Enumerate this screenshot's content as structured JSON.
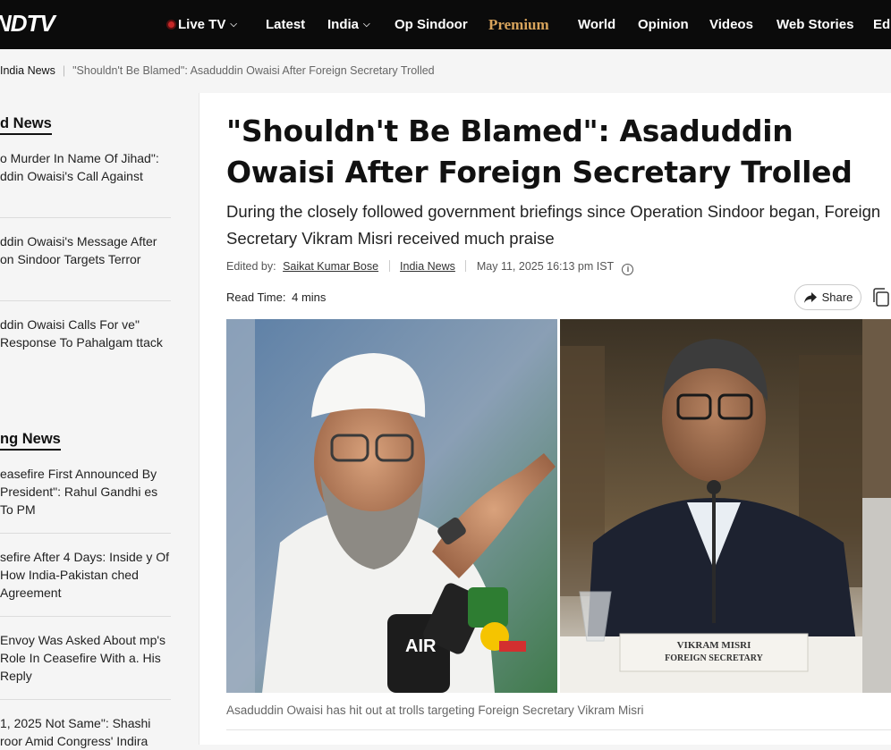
{
  "nav": {
    "logo": "NDTV",
    "items": [
      {
        "label": "Live TV",
        "has_dot": true,
        "has_chevron": true
      },
      {
        "label": "Latest"
      },
      {
        "label": "India",
        "has_chevron": true
      },
      {
        "label": "Op Sindoor"
      },
      {
        "label": "Premium"
      },
      {
        "label": "World"
      },
      {
        "label": "Opinion"
      },
      {
        "label": "Videos"
      },
      {
        "label": "Web Stories"
      },
      {
        "label": "Edu"
      }
    ]
  },
  "breadcrumb": {
    "parent": "India News",
    "current": "\"Shouldn't Be Blamed\": Asaduddin Owaisi After Foreign Secretary Trolled"
  },
  "sidebar": {
    "sections": [
      {
        "title": "d News",
        "items": [
          {
            "text": "o Murder In Name Of Jihad\": ddin Owaisi's Call Against"
          },
          {
            "text": "ddin Owaisi's Message After on Sindoor Targets Terror"
          },
          {
            "text": "ddin Owaisi Calls For ve\" Response To Pahalgam ttack"
          }
        ]
      },
      {
        "title": "ng News",
        "items": [
          {
            "text": "easefire First Announced By President\": Rahul Gandhi es To PM"
          },
          {
            "text": "sefire After 4 Days: Inside y Of How India-Pakistan ched Agreement"
          },
          {
            "text": "Envoy Was Asked About mp's Role In Ceasefire With a. His Reply"
          },
          {
            "text": "1, 2025 Not Same\": Shashi roor Amid Congress' Indira"
          }
        ]
      }
    ]
  },
  "article": {
    "headline": "\"Shouldn't Be Blamed\": Asaduddin Owaisi After Foreign Secretary Trolled",
    "subhead": "During the closely followed government briefings since Operation Sindoor began, Foreign Secretary Vikram Misri received much praise",
    "meta": {
      "edited_by_label": "Edited by:",
      "author": "Saikat Kumar Bose",
      "category": "India News",
      "date": "May 11, 2025 16:13 pm IST"
    },
    "read_time_label": "Read Time:",
    "read_time_value": "4 mins",
    "share_label": "Share",
    "placard_line1": "VIKRAM MISRI",
    "placard_line2": "FOREIGN SECRETARY",
    "mic_label": "AIR",
    "caption": "Asaduddin Owaisi has hit out at trolls targeting Foreign Secretary Vikram Misri"
  },
  "colors": {
    "nav_bg": "#0b0b0b",
    "premium": "#d8a45c",
    "live_dot": "#c62828"
  }
}
